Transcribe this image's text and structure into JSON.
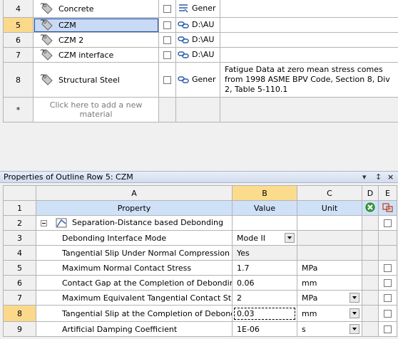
{
  "outline": {
    "rows": [
      {
        "num": "4",
        "name": "Concrete",
        "source": "Gener",
        "description": "",
        "selected": false
      },
      {
        "num": "5",
        "name": "CZM",
        "source": "D:\\AU",
        "description": "",
        "selected": true
      },
      {
        "num": "6",
        "name": "CZM 2",
        "source": "D:\\AU",
        "description": "",
        "selected": false
      },
      {
        "num": "7",
        "name": "CZM interface",
        "source": "D:\\AU",
        "description": "",
        "selected": false
      },
      {
        "num": "8",
        "name": "Structural Steel",
        "source": "Gener",
        "description": "Fatigue Data at zero mean stress comes from 1998 ASME BPV Code, Section 8, Div 2, Table 5-110.1",
        "selected": false
      }
    ],
    "add_row": {
      "num": "*",
      "text": "Click here to add a new material"
    }
  },
  "properties": {
    "title": "Properties of Outline Row 5: CZM",
    "controls": {
      "dropdown": "▾",
      "pin": "↕",
      "close": "×"
    },
    "columns": {
      "A": "A",
      "B": "B",
      "C": "C",
      "D": "D",
      "E": "E"
    },
    "header": {
      "num": "1",
      "property": "Property",
      "value": "Value",
      "unit": "Unit"
    },
    "group": {
      "num": "2",
      "label": "Separation-Distance based Debonding"
    },
    "rows": [
      {
        "num": "3",
        "property": "Debonding Interface Mode",
        "value": "Mode II",
        "unit": "",
        "value_dd": true,
        "unit_dd": false,
        "checkbox": false
      },
      {
        "num": "4",
        "property": "Tangential Slip Under Normal Compression",
        "value": "Yes",
        "unit": "",
        "value_dd": false,
        "unit_dd": false,
        "checkbox": false
      },
      {
        "num": "5",
        "property": "Maximum Normal Contact Stress",
        "value": "1.7",
        "unit": "MPa",
        "value_dd": false,
        "unit_dd": false,
        "checkbox": true
      },
      {
        "num": "6",
        "property": "Contact Gap at the Completion of Debonding",
        "value": "0.06",
        "unit": "mm",
        "value_dd": false,
        "unit_dd": false,
        "checkbox": true
      },
      {
        "num": "7",
        "property": "Maximum Equivalent Tangential Contact Stress",
        "value": "2",
        "unit": "MPa",
        "value_dd": false,
        "unit_dd": true,
        "checkbox": true
      },
      {
        "num": "8",
        "property": "Tangential Slip at the Completion of Debonding",
        "value": "0.03",
        "unit": "mm",
        "value_dd": false,
        "unit_dd": true,
        "checkbox": true
      },
      {
        "num": "9",
        "property": "Artificial Damping Coefficient",
        "value": "1E-06",
        "unit": "s",
        "value_dd": false,
        "unit_dd": true,
        "checkbox": true
      }
    ]
  },
  "colors": {
    "selected_row_num": "#fbd98b",
    "selected_cell": "#c9daf4",
    "header_label": "#cfe1f7"
  }
}
